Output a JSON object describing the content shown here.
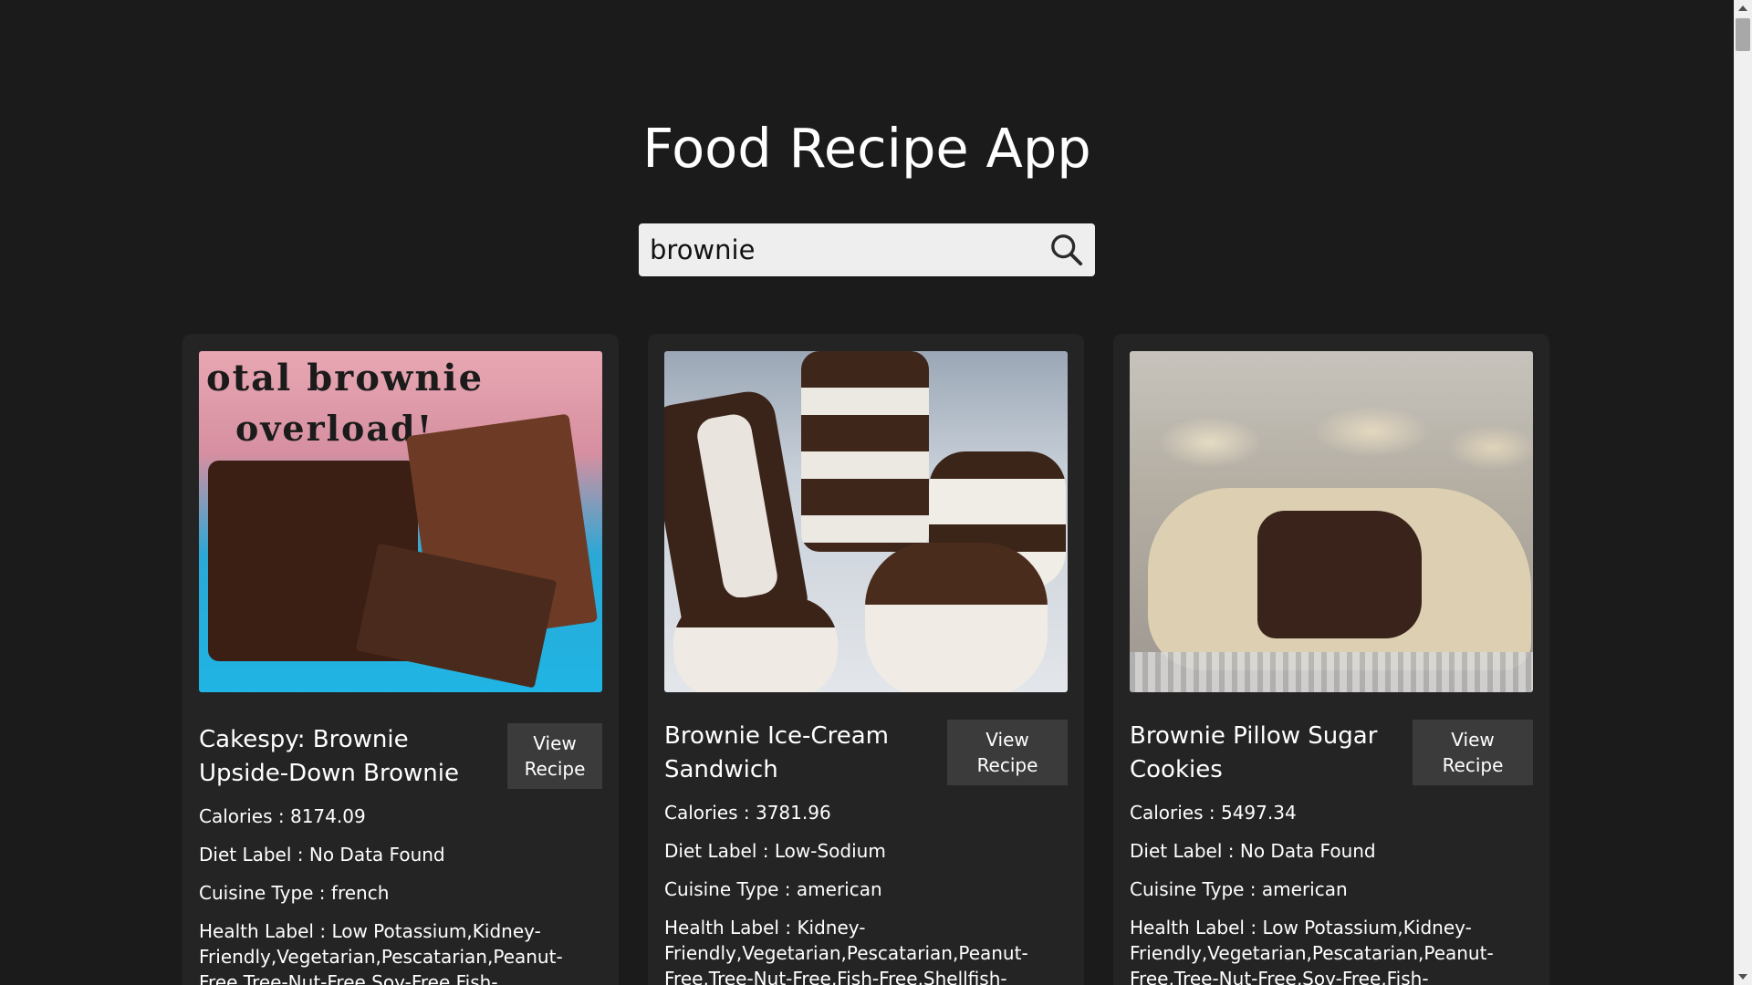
{
  "app": {
    "title": "Food Recipe App"
  },
  "search": {
    "value": "brownie",
    "button_icon": "search-icon"
  },
  "recipes": [
    {
      "title": "Cakespy: Brownie Upside-Down Brownie",
      "button_label": "View Recipe",
      "calories": "Calories : 8174.09",
      "diet_label": "Diet Label : No Data Found",
      "cuisine_type": "Cuisine Type : french",
      "health_label": "Health Label : Low Potassium,Kidney-Friendly,Vegetarian,Pescatarian,Peanut-Free,Tree-Nut-Free,Soy-Free,Fish-",
      "image_doodle_line1": "otal brownie",
      "image_doodle_line2": "overload!"
    },
    {
      "title": "Brownie Ice-Cream Sandwich",
      "button_label": "View Recipe",
      "calories": "Calories : 3781.96",
      "diet_label": "Diet Label : Low-Sodium",
      "cuisine_type": "Cuisine Type : american",
      "health_label": "Health Label : Kidney-Friendly,Vegetarian,Pescatarian,Peanut-Free,Tree-Nut-Free,Fish-Free,Shellfish-"
    },
    {
      "title": "Brownie Pillow Sugar Cookies",
      "button_label": "View Recipe",
      "calories": "Calories : 5497.34",
      "diet_label": "Diet Label : No Data Found",
      "cuisine_type": "Cuisine Type : american",
      "health_label": "Health Label : Low Potassium,Kidney-Friendly,Vegetarian,Pescatarian,Peanut-Free,Tree-Nut-Free,Soy-Free,Fish-"
    }
  ]
}
